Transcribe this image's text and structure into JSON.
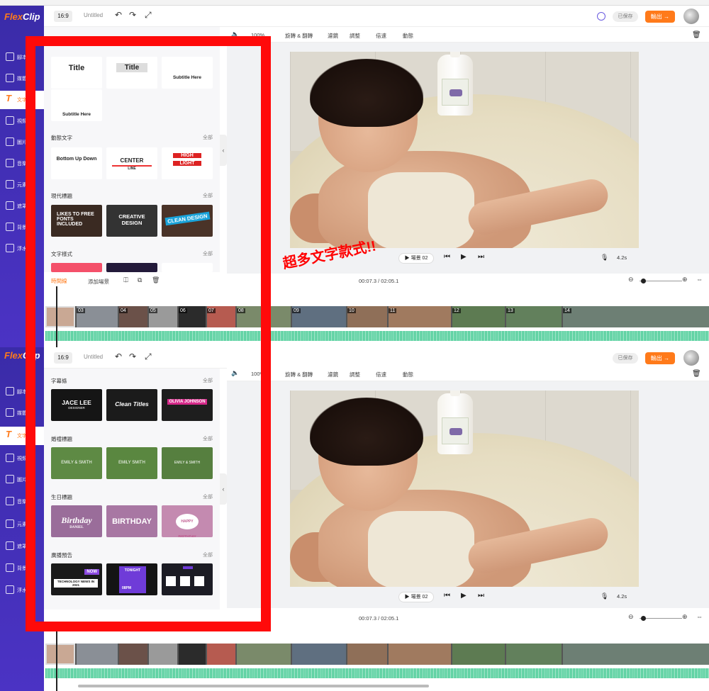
{
  "app": {
    "logo_main": "Flex",
    "logo_accent": "Clip"
  },
  "topbar": {
    "ratio": "16:9",
    "title": "Untitled",
    "saved": "已保存",
    "export": "輸出 →"
  },
  "nav_items": [
    "腳本",
    "媒體",
    "文字",
    "視頻",
    "圖片",
    "音樂",
    "元素",
    "遮罩",
    "背景",
    "浮水印"
  ],
  "toolbar": {
    "volume_zoom": "100%",
    "rotate": "旋轉 & 翻轉",
    "filter": "濾鏡",
    "adjust": "調整",
    "speed": "倍速",
    "animation": "動態"
  },
  "top_panel": {
    "basic_cards": [
      "Title",
      "Title",
      "Subtitle Here",
      "Subtitle Here"
    ],
    "section_dynamic": "動態文字",
    "dynamic_cards": [
      "Bottom Up Down",
      "CENTER",
      "LINE",
      "HIGH",
      "LIGHT"
    ],
    "section_modern": "現代標題",
    "modern_cards": [
      "LIKES TO FREE FONTS INCLUDED",
      "CREATIVE DESIGN",
      "CLEAN DESIGN"
    ],
    "section_style": "文字樣式",
    "all_label": "全部"
  },
  "bottom_panel": {
    "section_lower": "字幕條",
    "lower_cards": [
      "JACE LEE",
      "DESIGNER",
      "Clean Titles",
      "OLIVIA JOHNSON"
    ],
    "section_wedding": "婚禮標題",
    "wedding_cards": [
      "EMILY & SMITH",
      "EMILY SMITH",
      "EMILY & SMITH"
    ],
    "section_birthday": "生日標題",
    "birthday_cards": [
      "Birthday",
      "DANIEL",
      "BIRTHDAY",
      "HAPPY BIRTHDAY"
    ],
    "section_broadcast": "廣播預告",
    "broadcast_cards": [
      "NOW",
      "TECHNOLOGY NEWS IN 2021",
      "TONIGHT",
      "08PM"
    ],
    "all_label": "全部"
  },
  "player": {
    "scene": "▶ 場景 02",
    "duration": "4.2s"
  },
  "timeline": {
    "mode": "時間線",
    "add_scene": "添加場景",
    "time": "00:07.3 / 02:05.1"
  },
  "clips": [
    "03",
    "04",
    "05",
    "06",
    "07",
    "08",
    "09",
    "10",
    "11",
    "12",
    "13",
    "14"
  ],
  "annotation": "超多文字款式!!",
  "colors": {
    "brand_purple": "#4b33c4",
    "accent_orange": "#ff7a1a",
    "annotation_red": "#ff0a0a",
    "waveform": "#33c48a"
  }
}
